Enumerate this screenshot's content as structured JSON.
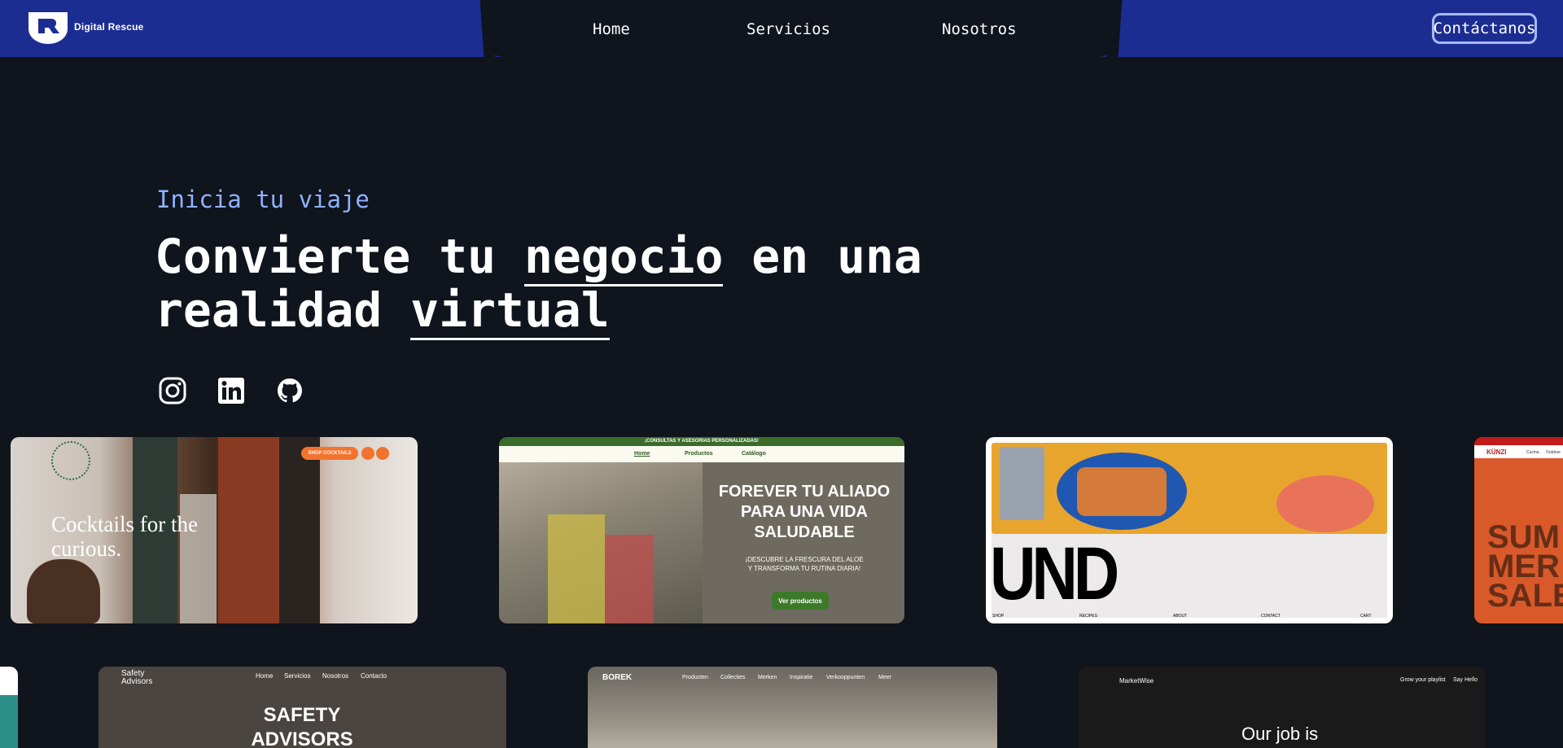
{
  "header": {
    "logo_text": "Digital Rescue",
    "nav": [
      "Home",
      "Servicios",
      "Nosotros"
    ],
    "cta": "Contáctanos",
    "colors": {
      "bar": "#1c2d92",
      "background": "#0f141d",
      "accent": "#8fb2ff"
    }
  },
  "hero": {
    "eyebrow": "Inicia tu viaje",
    "headline_part1": "Convierte tu ",
    "headline_word1": "negocio",
    "headline_part2": " en una",
    "headline_part3": "realidad ",
    "headline_word2": "virtual",
    "socials": [
      "instagram-icon",
      "linkedin-icon",
      "github-icon"
    ]
  },
  "portfolio": {
    "civil_pours": {
      "title": "Cocktails for the curious.",
      "pill": "SHOP COCKTAILS"
    },
    "forever": {
      "topbar": "¡CONSULTAS Y ASESORIAS PERSONALIZADAS!",
      "nav": [
        "Home",
        "Productos",
        "Catálogo"
      ],
      "headline": "FOREVER TU ALIADO PARA UNA VIDA SALUDABLE",
      "sub": "¡DESCUBRE LA FRESCURA DEL ALOE Y TRANSFORMA TU RUTINA DIARIA!",
      "cta": "Ver productos"
    },
    "und": {
      "logo": "UND",
      "footer": [
        "SHOP",
        "RECIPES",
        "ABOUT",
        "CONTACT",
        "CART"
      ]
    },
    "kunzi": {
      "brand": "KÜNZI",
      "nav": [
        "Cucina",
        "Outdoor"
      ],
      "sale": "SUM MER SALE"
    },
    "safety": {
      "brand": "Safety Advisors",
      "nav": [
        "Home",
        "Servicios",
        "Nosotros",
        "Contacto"
      ],
      "title": "SAFETY ADVISORS"
    },
    "borek": {
      "brand": "BOREK",
      "nav": [
        "Producten",
        "Collecties",
        "Merken",
        "Inspiratie",
        "Verkooppunten",
        "Meer"
      ]
    },
    "marketwise": {
      "brand": "MarketWise",
      "nav": [
        "Grow your playlist",
        "Say Hello"
      ],
      "title": "Our job is"
    }
  }
}
